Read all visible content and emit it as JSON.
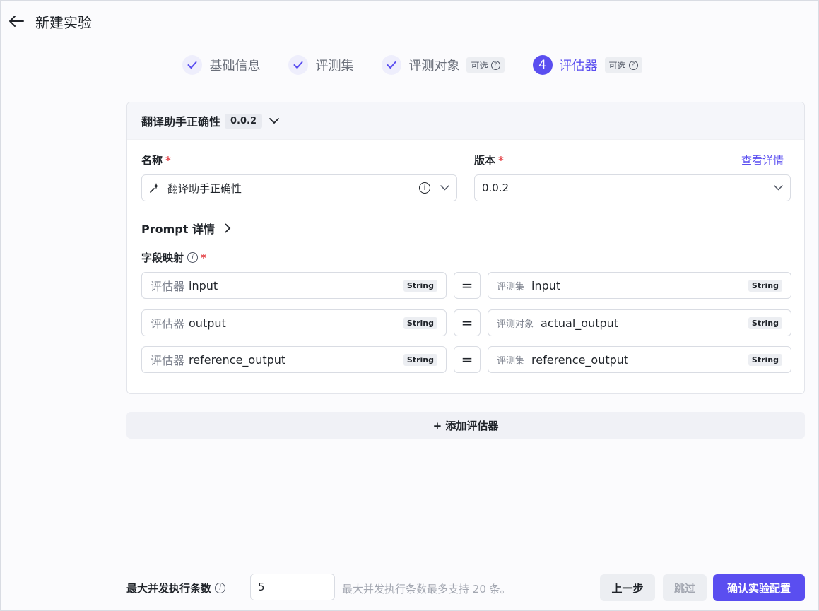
{
  "header": {
    "title": "新建实验"
  },
  "steps": [
    {
      "label": "基础信息"
    },
    {
      "label": "评测集"
    },
    {
      "label": "评测对象",
      "optional": "可选"
    },
    {
      "number": "4",
      "label": "评估器",
      "optional": "可选"
    }
  ],
  "evaluator": {
    "title": "翻译助手正确性",
    "version": "0.0.2",
    "name_label": "名称",
    "version_label": "版本",
    "required_mark": "*",
    "view_details": "查看详情",
    "name_value": "翻译助手正确性",
    "version_value": "0.0.2",
    "prompt_details": "Prompt 详情",
    "field_mapping_label": "字段映射",
    "info_glyph": "i",
    "eq": "=",
    "mappings": [
      {
        "left_prefix": "评估器",
        "left_name": "input",
        "left_type": "String",
        "right_prefix": "评测集",
        "right_name": "input",
        "right_type": "String"
      },
      {
        "left_prefix": "评估器",
        "left_name": "output",
        "left_type": "String",
        "right_prefix": "评测对象",
        "right_name": "actual_output",
        "right_type": "String"
      },
      {
        "left_prefix": "评估器",
        "left_name": "reference_output",
        "left_type": "String",
        "right_prefix": "评测集",
        "right_name": "reference_output",
        "right_type": "String"
      }
    ]
  },
  "add_evaluator": "+ 添加评估器",
  "footer": {
    "concurrency_label": "最大并发执行条数",
    "concurrency_value": "5",
    "hint": "最大并发执行条数最多支持 20 条。",
    "prev": "上一步",
    "skip": "跳过",
    "confirm": "确认实验配置"
  },
  "colors": {
    "accent": "#5a4ef0",
    "required": "#e5484d"
  }
}
